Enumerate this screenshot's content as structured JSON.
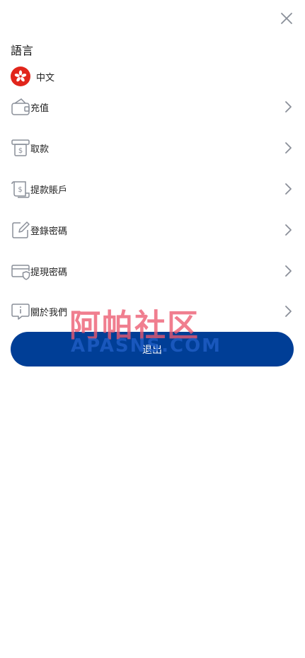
{
  "header": {
    "close_icon": "close-icon"
  },
  "language": {
    "title": "語言",
    "current": "中文",
    "flag_icon": "hong-kong-flag-icon",
    "flag_color": "#e1251b"
  },
  "menu": {
    "items": [
      {
        "label": "充值",
        "icon": "wallet-icon"
      },
      {
        "label": "取款",
        "icon": "withdraw-icon"
      },
      {
        "label": "提款賬戶",
        "icon": "account-icon"
      },
      {
        "label": "登錄密碼",
        "icon": "edit-icon"
      },
      {
        "label": "提現密碼",
        "icon": "card-shield-icon"
      },
      {
        "label": "關於我們",
        "icon": "info-chat-icon"
      }
    ]
  },
  "logout": {
    "label": "退出",
    "color": "#003e96"
  },
  "watermark": {
    "line1": "阿帕社区",
    "line2": "APASNS.COM"
  }
}
